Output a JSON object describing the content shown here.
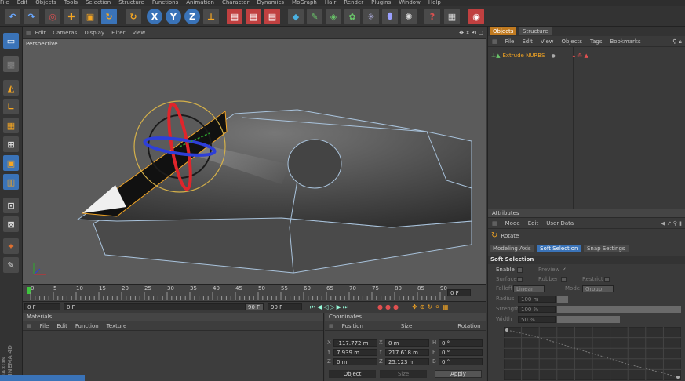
{
  "menubar": [
    "File",
    "Edit",
    "Objects",
    "Tools",
    "Selection",
    "Structure",
    "Functions",
    "Animation",
    "Character",
    "Dynamics",
    "MoGraph",
    "Hair",
    "Render",
    "Plugins",
    "Window",
    "Help"
  ],
  "viewport": {
    "menu": [
      "Edit",
      "Cameras",
      "Display",
      "Filter",
      "View"
    ],
    "label": "Perspective"
  },
  "timeline": {
    "ticks": [
      "0",
      "5",
      "10",
      "15",
      "20",
      "25",
      "30",
      "35",
      "40",
      "45",
      "50",
      "55",
      "60",
      "65",
      "70",
      "75",
      "80",
      "85",
      "90"
    ],
    "current_frame": "0 F",
    "start": "0 F",
    "min": "0 F",
    "max": "90 F",
    "end": "90 F"
  },
  "materials": {
    "title": "Materials",
    "menu": [
      "File",
      "Edit",
      "Function",
      "Texture"
    ]
  },
  "coordinates": {
    "title": "Coordinates",
    "headers": [
      "Position",
      "Size",
      "Rotation"
    ],
    "rows": [
      {
        "axis": "X",
        "pos": "-117.772 m",
        "saxis": "X",
        "size": "0 m",
        "raxis": "H",
        "rot": "0 °"
      },
      {
        "axis": "Y",
        "pos": "7.939 m",
        "saxis": "Y",
        "size": "217.618 m",
        "raxis": "P",
        "rot": "0 °"
      },
      {
        "axis": "Z",
        "pos": "0 m",
        "saxis": "Z",
        "size": "25.123 m",
        "raxis": "B",
        "rot": "0 °"
      }
    ],
    "mode": "Object",
    "size_mode": "Size",
    "apply": "Apply"
  },
  "objects": {
    "tabs": [
      "Objects",
      "Structure"
    ],
    "menu": [
      "File",
      "Edit",
      "View",
      "Objects",
      "Tags",
      "Bookmarks"
    ],
    "items": [
      {
        "name": "Extrude NURBS"
      }
    ]
  },
  "attributes": {
    "title": "Attributes",
    "menu": [
      "Mode",
      "Edit",
      "User Data"
    ],
    "tool": "Rotate",
    "tabs": [
      "Modeling Axis",
      "Soft Selection",
      "Snap Settings"
    ],
    "section": "Soft Selection",
    "enable": "Enable",
    "preview": "Preview",
    "surface": "Surface",
    "rubber": "Rubber",
    "restrict": "Restrict",
    "falloff_label": "Falloff",
    "falloff": "Linear",
    "mode_label": "Mode",
    "mode": "Group",
    "radius_label": "Radius",
    "radius": "100 m",
    "strength_label": "Strength",
    "strength": "100 %",
    "width_label": "Width",
    "width": "50 %"
  },
  "brand": "MAXON CINEMA 4D",
  "colors": {
    "accent": "#f5a623",
    "selection": "#3a73b8",
    "red_axis": "#e0252b",
    "blue_axis": "#2e3fd8",
    "green_axis": "#2ea82e"
  }
}
